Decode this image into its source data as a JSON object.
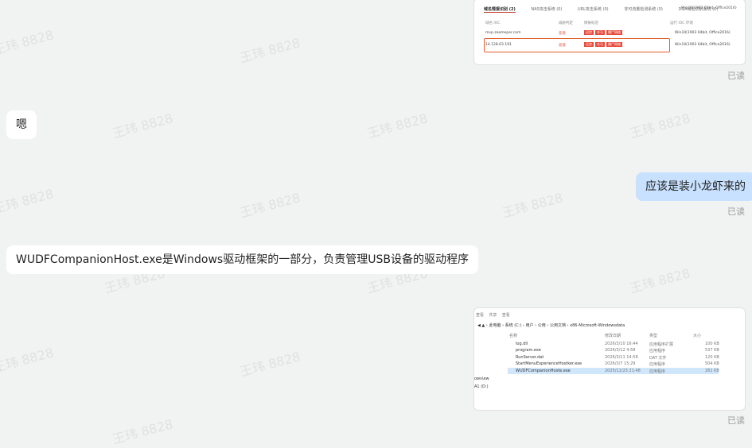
{
  "messages": {
    "m1": {
      "text": "嗯"
    },
    "m2": {
      "text": "应该是装小龙虾来的"
    },
    "m3": {
      "text": "WUDFCompanionHost.exe是Windows驱动框架的一部分，负责管理USB设备的驱动程序"
    }
  },
  "read_label": "已读",
  "watermark": "王玮 8828",
  "screenshot1": {
    "header_fragment": "Win10(1903 64bit, Office2016)",
    "tabs": [
      "域名情报识别 (2)",
      "NAS攻击系统 (0)",
      "URL攻击系统 (0)",
      "非可流量检测系统 (0)",
      "DGA域名识别系统 (0)"
    ],
    "columns": [
      "域名 IOC",
      "威胁判定",
      "情报标签",
      "运行 IOC 环境"
    ],
    "rows": [
      {
        "ioc": "mvp.zeomeper.com",
        "verdict": "恶意",
        "tags": [
          "远控",
          "木马",
          "僵尸网络"
        ],
        "env": "Win10(1903 64bit, Office2016)"
      },
      {
        "ioc": "14.128.63.191",
        "verdict": "恶意",
        "tags": [
          "远控",
          "木马",
          "僵尸网络"
        ],
        "env": "Win10(1903 64bit, Office2016)"
      }
    ]
  },
  "screenshot2": {
    "menu": [
      "查看",
      "共享",
      "查看"
    ],
    "breadcrumb": [
      "此电脑",
      "系统 (C:)",
      "用户",
      "公用",
      "公用文档",
      "x86-Microsoft-Windowsdata"
    ],
    "columns": [
      "名称",
      "修改日期",
      "类型",
      "大小"
    ],
    "files": [
      {
        "name": "log.dll",
        "date": "2026/3/10 16:44",
        "type": "应用程序扩展",
        "size": "100 KB"
      },
      {
        "name": "program.exe",
        "date": "2026/3/12 4:58",
        "type": "应用程序",
        "size": "537 KB"
      },
      {
        "name": "RunServer.dat",
        "date": "2026/3/11 14:58",
        "type": "DAT 文件",
        "size": "120 KB"
      },
      {
        "name": "StartMenuExperienceHostker.exe",
        "date": "2026/3/7 15:29",
        "type": "应用程序",
        "size": "504 KB"
      },
      {
        "name": "WUDFCompanionHoste.exe",
        "date": "2025/11/23 21:48",
        "type": "应用程序",
        "size": "261 KB"
      }
    ],
    "sidebar_fragments": [
      "ows\\ew",
      "A1 (D:)"
    ]
  }
}
